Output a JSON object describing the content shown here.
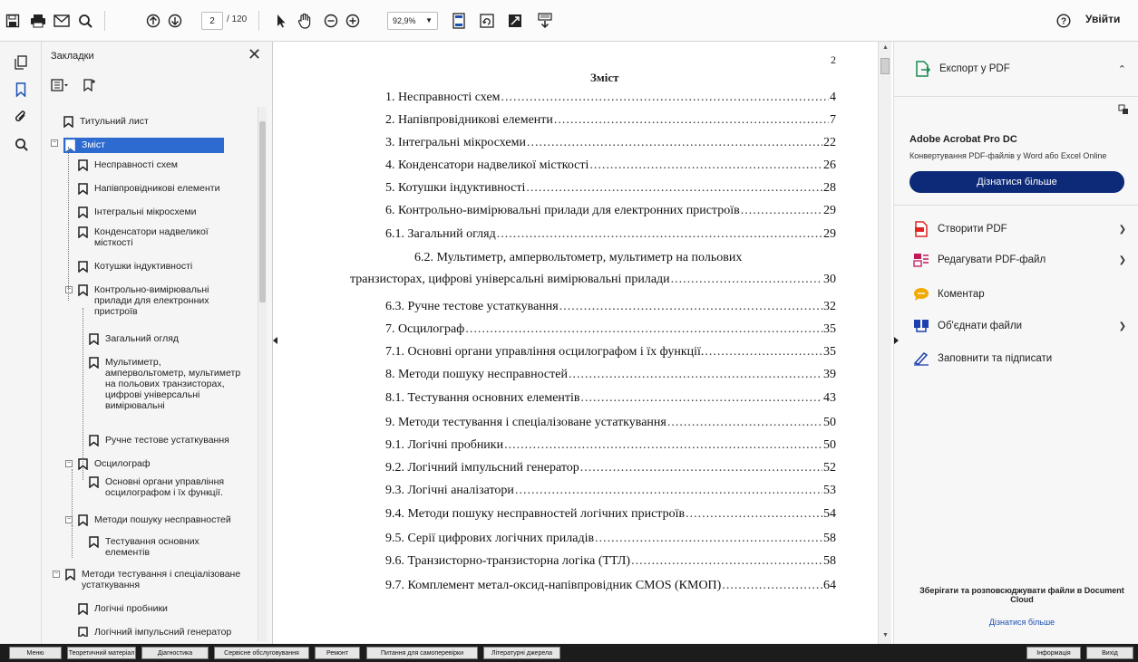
{
  "toolbar": {
    "page_current": "2",
    "page_total": "/ 120",
    "zoom": "92,9%",
    "signin_label": "Увійти"
  },
  "bookmarks": {
    "title": "Закладки",
    "items": [
      {
        "label": "Титульний лист"
      },
      {
        "label": "Зміст"
      },
      {
        "label": "Несправності схем"
      },
      {
        "label": "Напівпровідникові елементи"
      },
      {
        "label": "Інтегральні мікросхеми"
      },
      {
        "label": "Конденсатори надвеликої місткості"
      },
      {
        "label": "Котушки індуктивності"
      },
      {
        "label": "Контрольно-вимірювальні прилади для електронних пристроїв"
      },
      {
        "label": "Загальний огляд"
      },
      {
        "label": "Мультиметр, ампервольтометр, мультиметр на польових транзисторах, цифрові універсальні вимірювальні"
      },
      {
        "label": "Ручне тестове устаткування"
      },
      {
        "label": "Осцилограф"
      },
      {
        "label": "Основні органи управління осцилографом і їх функції."
      },
      {
        "label": "Методи пошуку несправностей"
      },
      {
        "label": "Тестування основних елементів"
      },
      {
        "label": "Методи тестування і спеціалізоване устаткування"
      },
      {
        "label": "Логічні пробники"
      },
      {
        "label": "Логічний імпульсний генератор"
      }
    ]
  },
  "document": {
    "page_number": "2",
    "title": "Зміст",
    "toc": [
      {
        "text": "1. Несправності схем",
        "page": "4"
      },
      {
        "text": "2. Напівпровідникові елементи",
        "page": "7"
      },
      {
        "text": "3. Інтегральні мікросхеми",
        "page": "22"
      },
      {
        "text": "4. Конденсатори надвеликої місткості",
        "page": "26"
      },
      {
        "text": "5. Котушки індуктивності",
        "page": "28"
      },
      {
        "text": "6. Контрольно-вимірювальні прилади для електронних пристроїв",
        "page": "29"
      },
      {
        "text": "6.1. Загальний огляд",
        "page": "29"
      },
      {
        "text": "6.2. Мультиметр, ампервольтометр, мультиметр на польових",
        "page": ""
      },
      {
        "text": "транзисторах, цифрові універсальні вимірювальні прилади",
        "page": "30"
      },
      {
        "text": "6.3. Ручне тестове устаткування",
        "page": "32"
      },
      {
        "text": "7. Осцилограф",
        "page": "35"
      },
      {
        "text": "7.1. Основні органи управління осцилографом і їх функції.",
        "page": "35"
      },
      {
        "text": "8. Методи пошуку несправностей",
        "page": "39"
      },
      {
        "text": "8.1. Тестування основних елементів",
        "page": "43"
      },
      {
        "text": "9. Методи тестування і спеціалізоване устаткування",
        "page": "50"
      },
      {
        "text": "9.1. Логічні пробники",
        "page": "50"
      },
      {
        "text": "9.2. Логічний імпульсний генератор",
        "page": "52"
      },
      {
        "text": "9.3. Логічні аналізатори",
        "page": "53"
      },
      {
        "text": "9.4. Методи пошуку несправностей логічних пристроїв",
        "page": "54"
      },
      {
        "text": "9.5. Серії цифрових логічних приладів",
        "page": "58"
      },
      {
        "text": "9.6. Транзисторно-транзисторна логіка (ТТЛ)",
        "page": "58"
      },
      {
        "text": "9.7. Комплемент метал-оксид-напівпровідник CMOS (КМОП)",
        "page": "64"
      }
    ]
  },
  "right_panel": {
    "export_label": "Експорт у PDF",
    "acrobat_title": "Adobe Acrobat Pro DC",
    "acrobat_desc": "Конвертування PDF-файлів у Word або Excel Online",
    "learn_more_button": "Дізнатися більше",
    "tools": [
      {
        "label": "Створити PDF"
      },
      {
        "label": "Редагувати PDF-файл"
      },
      {
        "label": "Коментар"
      },
      {
        "label": "Об'єднати файли"
      },
      {
        "label": "Заповнити та підписати"
      }
    ],
    "doc_cloud_text": "Зберігати та розповсюджувати файли в Document Cloud",
    "doc_cloud_link": "Дізнатися більше"
  },
  "bottom_bar": {
    "buttons": [
      "Меню",
      "Теоретичний матеріал",
      "Діагностика",
      "Сервісне обслуговування",
      "Ремонт",
      "Питання для самоперевірки",
      "Літературні джерела",
      "Інформація",
      "Вихід"
    ]
  },
  "colors": {
    "accent": "#0d2a78",
    "selection": "#2d6bd1",
    "create_pdf": "#e02424",
    "edit_pdf": "#c2185b",
    "comment": "#f2a900",
    "combine": "#1e40af"
  }
}
